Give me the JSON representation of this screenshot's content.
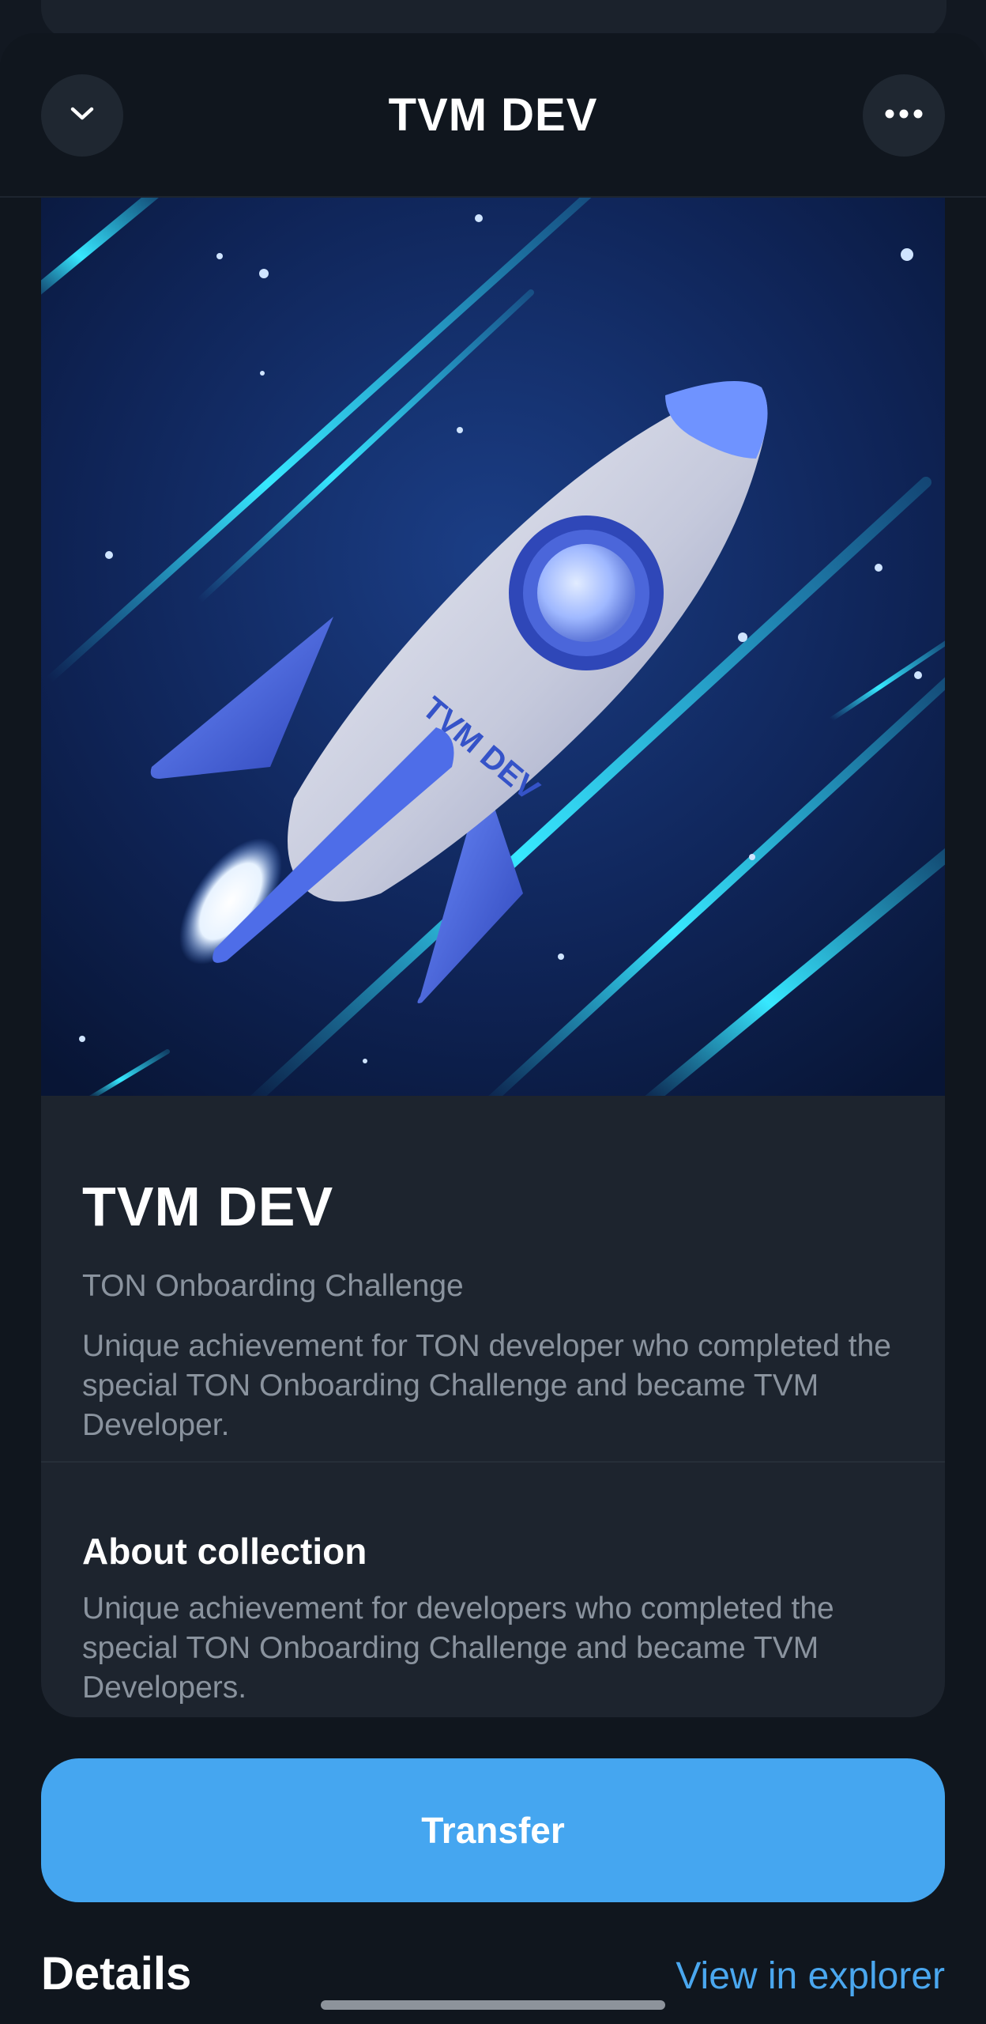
{
  "header": {
    "title": "TVM DEV",
    "collapse_icon": "chevron-down-icon",
    "menu_icon": "more-horizontal-icon"
  },
  "nft": {
    "image_text": "TVM DEV",
    "name": "TVM DEV",
    "collection": "TON Onboarding Challenge",
    "description": "Unique achievement for TON developer who completed the special TON Onboarding Challenge and became TVM Developer."
  },
  "about": {
    "title": "About collection",
    "description": "Unique achievement for developers who completed the special TON Onboarding Challenge and became TVM Developers."
  },
  "actions": {
    "transfer_label": "Transfer"
  },
  "details": {
    "title": "Details",
    "explorer_link": "View in explorer"
  },
  "colors": {
    "background": "#10161e",
    "card": "#1d242e",
    "accent": "#45a6f0",
    "secondary_text": "#8a939e"
  }
}
